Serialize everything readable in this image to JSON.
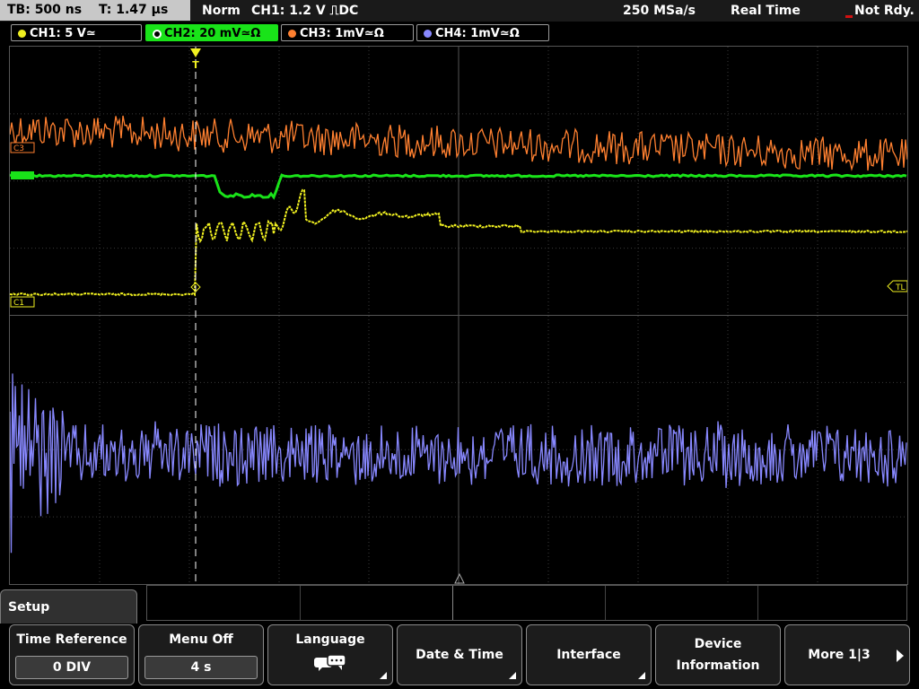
{
  "status": {
    "timebase": "TB: 500 ns",
    "trigger_time": "T: 1.47 µs",
    "trigger_mode": "Norm",
    "trigger_info": "CH1: 1.2 V ⎍DC",
    "sample_rate": "250 MSa/s",
    "acq_mode": "Real Time",
    "state": "Not Rdy."
  },
  "channels": [
    {
      "label": "CH1: 5 V≃",
      "color": "#f0f020"
    },
    {
      "label": "CH2: 20 mV≃Ω",
      "color": "#19e319"
    },
    {
      "label": "CH3: 1mV≃Ω",
      "color": "#ff8030"
    },
    {
      "label": "CH4: 1mV≃Ω",
      "color": "#8888ff"
    }
  ],
  "markers": {
    "c3": "C3",
    "c1": "C1",
    "trigger_level": "TL",
    "trigger_point": "T"
  },
  "menu": {
    "title": "Setup",
    "softkeys": [
      {
        "label": "Time Reference",
        "value": "0 DIV"
      },
      {
        "label": "Menu Off",
        "value": "4 s"
      },
      {
        "label": "Language"
      },
      {
        "label": "Date & Time"
      },
      {
        "label": "Interface"
      },
      {
        "label": "Device Information"
      },
      {
        "label": "More 1|3"
      }
    ]
  }
}
